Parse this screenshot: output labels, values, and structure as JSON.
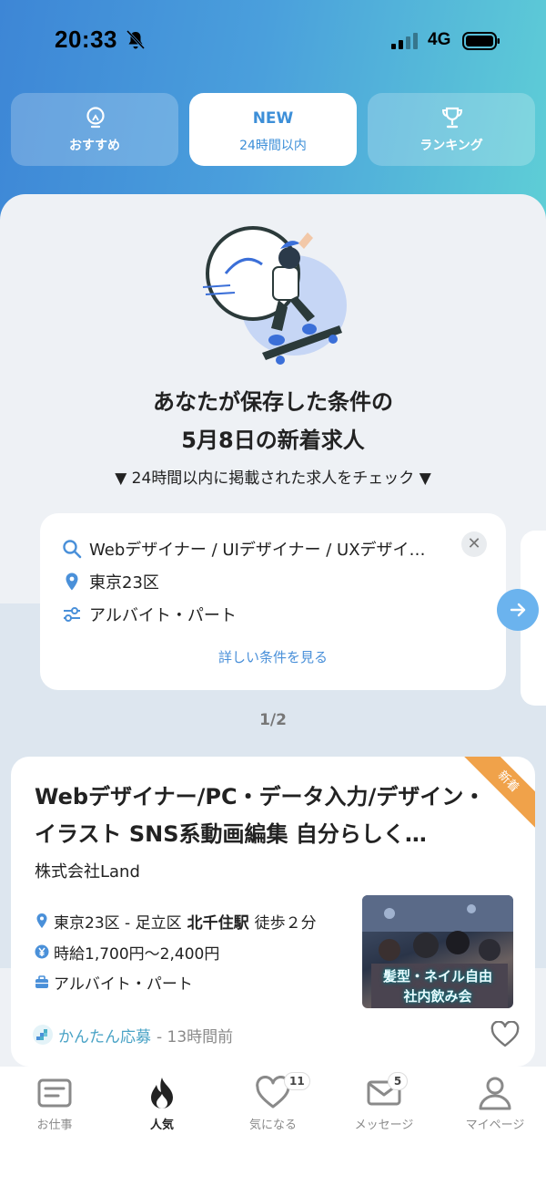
{
  "status_bar": {
    "time": "20:33",
    "network": "4G"
  },
  "tabs": [
    {
      "label": "おすすめ",
      "icon": "lightbulb-icon"
    },
    {
      "badge": "NEW",
      "label": "24時間以内",
      "icon": ""
    },
    {
      "label": "ランキング",
      "icon": "trophy-icon"
    }
  ],
  "hero": {
    "headline_line1": "あなたが保存した条件の",
    "headline_line2": "5月8日の新着求人",
    "subline": "▼ 24時間以内に掲載された求人をチェック ▼"
  },
  "saved_condition": {
    "keyword": "Webデザイナー / UIデザイナー / UXデザイ…",
    "location": "東京23区",
    "employment_type": "アルバイト・パート",
    "detail_link": "詳しい条件を見る",
    "close": "✕"
  },
  "pager": "1/2",
  "job": {
    "ribbon": "新着",
    "title": "Webデザイナー/PC・データ入力/デザイン・イラスト SNS系動画編集 自分らしく…",
    "company": "株式会社Land",
    "location": "東京23区 - 足立区",
    "station": "北千住駅",
    "walk": "徒歩２分",
    "wage": "時給1,700円〜2,400円",
    "employment_type": "アルバイト・パート",
    "photo_text_line1": "髪型・ネイル自由",
    "photo_text_line2": "社内飲み会",
    "apply_label": "かんたん応募",
    "posted": "- 13時間前"
  },
  "bottom_nav": [
    {
      "label": "お仕事",
      "icon": "job-list-icon"
    },
    {
      "label": "人気",
      "icon": "flame-icon"
    },
    {
      "label": "気になる",
      "icon": "heart-icon",
      "badge": "11"
    },
    {
      "label": "メッセージ",
      "icon": "mail-icon",
      "badge": "5"
    },
    {
      "label": "マイページ",
      "icon": "person-icon"
    }
  ],
  "colors": {
    "accent": "#3d8fd8",
    "header_gradient_start": "#3d86d6",
    "header_gradient_end": "#5fd0d6",
    "new_ribbon": "#f0a24a",
    "apply_label": "#4aa3c6"
  }
}
